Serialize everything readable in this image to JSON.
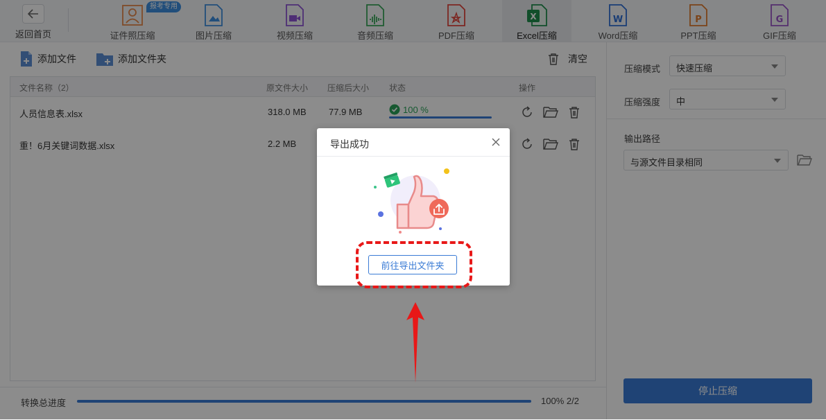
{
  "nav": {
    "back_label": "返回首页",
    "badge": "报考专用",
    "tabs": [
      {
        "label": "证件照压缩",
        "icon": "id-photo-icon",
        "color": "#e8894a"
      },
      {
        "label": "图片压缩",
        "icon": "image-file-icon",
        "color": "#3d8fe0"
      },
      {
        "label": "视频压缩",
        "icon": "video-file-icon",
        "color": "#8e55d6"
      },
      {
        "label": "音频压缩",
        "icon": "audio-file-icon",
        "color": "#3aa85b"
      },
      {
        "label": "PDF压缩",
        "icon": "pdf-file-icon",
        "color": "#e2453c"
      },
      {
        "label": "Excel压缩",
        "icon": "excel-file-icon",
        "color": "#1f8f4e",
        "active": true
      },
      {
        "label": "Word压缩",
        "icon": "word-file-icon",
        "color": "#2f6fd6"
      },
      {
        "label": "PPT压缩",
        "icon": "ppt-file-icon",
        "color": "#e07a2c"
      },
      {
        "label": "GIF压缩",
        "icon": "gif-file-icon",
        "color": "#9a55c9"
      }
    ]
  },
  "toolbar": {
    "add_file": "添加文件",
    "add_folder": "添加文件夹",
    "clear": "清空"
  },
  "table": {
    "headers": {
      "name": "文件名称（2）",
      "orig_size": "原文件大小",
      "comp_size": "压缩后大小",
      "status": "状态",
      "ops": "操作"
    },
    "rows": [
      {
        "name": "人员信息表.xlsx",
        "orig_size": "318.0 MB",
        "comp_size": "77.9 MB",
        "status": "100 %"
      },
      {
        "name": "重！6月关键词数据.xlsx",
        "orig_size": "2.2 MB",
        "comp_size": "",
        "status": ""
      }
    ]
  },
  "bottom": {
    "label": "转换总进度",
    "progress_text": "100% 2/2",
    "progress": 1.0
  },
  "settings": {
    "mode_label": "压缩模式",
    "mode_value": "快速压缩",
    "strength_label": "压缩强度",
    "strength_value": "中",
    "output_label": "输出路径",
    "output_value": "与源文件目录相同",
    "stop_button": "停止压缩"
  },
  "dialog": {
    "title": "导出成功",
    "button": "前往导出文件夹"
  },
  "colors": {
    "accent": "#3a7bd5",
    "success": "#2aa35a",
    "highlight": "#e81818"
  }
}
